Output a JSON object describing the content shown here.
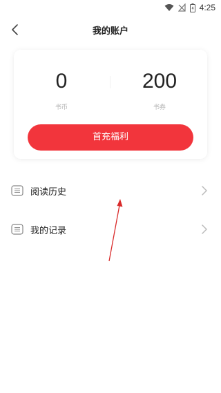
{
  "status": {
    "time": "4:25"
  },
  "header": {
    "title": "我的账户"
  },
  "account": {
    "coins_value": "0",
    "coins_label": "书币",
    "vouchers_value": "200",
    "vouchers_label": "书券",
    "cta_label": "首充福利"
  },
  "menu": {
    "items": [
      {
        "label": "阅读历史"
      },
      {
        "label": "我的记录"
      }
    ]
  },
  "colors": {
    "accent": "#f2353c",
    "annotation_arrow": "#d92b2b"
  }
}
